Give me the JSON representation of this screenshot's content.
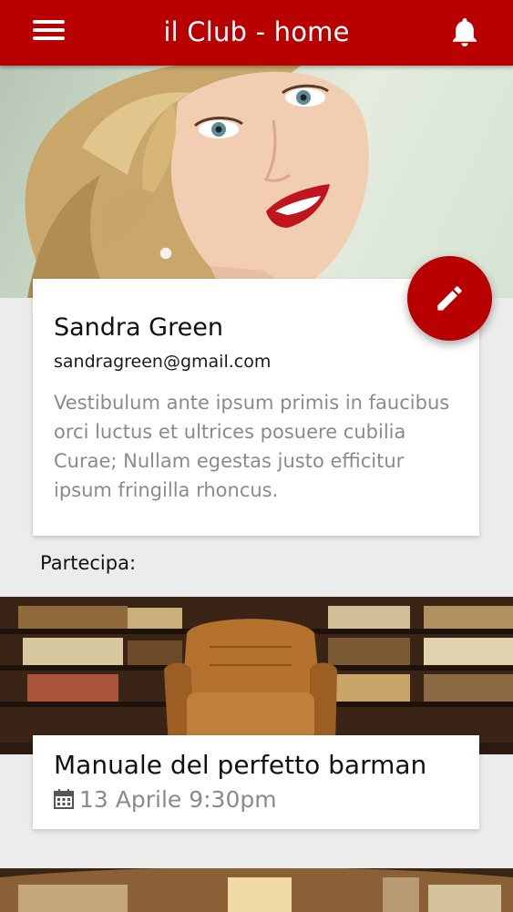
{
  "appbar": {
    "title": "il Club - home",
    "menu_icon": "hamburger-menu-icon",
    "notification_icon": "bell-icon",
    "color": "#b80000"
  },
  "profile": {
    "name": "Sandra Green",
    "email": "sandragreen@gmail.com",
    "bio": "Vestibulum ante ipsum primis in faucibus orci luctus et ultrices posuere cubilia Curae; Nullam egestas justo efficitur ipsum fringilla rhoncus.",
    "edit_icon": "pencil-icon"
  },
  "events_section": {
    "label": "Partecipa:",
    "events": [
      {
        "title": "Manuale del perfetto barman",
        "date": "13 Aprile 9:30pm",
        "date_icon": "calendar-icon"
      }
    ]
  },
  "colors": {
    "accent": "#b80000",
    "background": "#ececec",
    "muted_text": "#8a8a8a"
  }
}
